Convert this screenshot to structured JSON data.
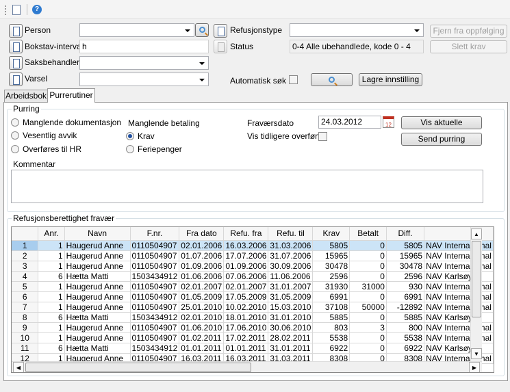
{
  "toolbar": {
    "icons": [
      "info-document-icon",
      "help-icon"
    ]
  },
  "filters": {
    "person_label": "Person",
    "person_value": "",
    "bokstav_label": "Bokstav-interval",
    "bokstav_value": "h",
    "saksbehandler_label": "Saksbehandler",
    "saksbehandler_value": "",
    "varsel_label": "Varsel",
    "varsel_value": "",
    "refusjonstype_label": "Refusjonstype",
    "refusjonstype_value": "",
    "status_label": "Status",
    "status_value": "0-4 Alle ubehandlede, kode 0 - 4",
    "automatisk_label": "Automatisk søk",
    "automatisk_checked": false,
    "fjern_label": "Fjern fra oppfølging",
    "slett_label": "Slett krav",
    "lagre_label": "Lagre innstilling"
  },
  "tabs": [
    {
      "label": "Arbeidsbok",
      "active": false
    },
    {
      "label": "Purrerutiner",
      "active": true
    }
  ],
  "purring": {
    "title": "Purring",
    "radios1": [
      "Manglende dokumentasjon",
      "Vesentlig avvik",
      "Overføres til HR"
    ],
    "heading2": "Manglende betaling",
    "radios2": [
      "Krav",
      "Feriepenger"
    ],
    "selected": "Krav",
    "fravaer_label": "Fraværsdato",
    "fravaer_value": "24.03.2012",
    "vis_tidligere_label": "Vis tidligere overført",
    "vis_tidligere_checked": false,
    "vis_aktuelle": "Vis aktuelle",
    "send_purring": "Send purring",
    "kommentar_label": "Kommentar",
    "kommentar_value": ""
  },
  "grid": {
    "title": "Refusjonsberettighet fravær",
    "columns": [
      "Anr.",
      "Navn",
      "F.nr.",
      "Fra dato",
      "Refu. fra",
      "Refu. til",
      "Krav",
      "Betalt",
      "Diff.",
      ""
    ],
    "rows": [
      [
        "1",
        "1",
        "Haugerud Anne",
        "0110504907",
        "02.01.2006",
        "16.03.2006",
        "31.03.2006",
        "5805",
        "0",
        "5805",
        "NAV Internasjonal"
      ],
      [
        "2",
        "1",
        "Haugerud Anne",
        "0110504907",
        "01.07.2006",
        "17.07.2006",
        "31.07.2006",
        "15965",
        "0",
        "15965",
        "NAV Internasjonal"
      ],
      [
        "3",
        "1",
        "Haugerud Anne",
        "0110504907",
        "01.09.2006",
        "01.09.2006",
        "30.09.2006",
        "30478",
        "0",
        "30478",
        "NAV Internasjonal"
      ],
      [
        "4",
        "6",
        "Hætta Matti",
        "1503434912",
        "01.06.2006",
        "07.06.2006",
        "11.06.2006",
        "2596",
        "0",
        "2596",
        "NAV Karlsøy"
      ],
      [
        "5",
        "1",
        "Haugerud Anne",
        "0110504907",
        "02.01.2007",
        "02.01.2007",
        "31.01.2007",
        "31930",
        "31000",
        "930",
        "NAV Internasjonal"
      ],
      [
        "6",
        "1",
        "Haugerud Anne",
        "0110504907",
        "01.05.2009",
        "17.05.2009",
        "31.05.2009",
        "6991",
        "0",
        "6991",
        "NAV Internasjonal"
      ],
      [
        "7",
        "1",
        "Haugerud Anne",
        "0110504907",
        "25.01.2010",
        "10.02.2010",
        "15.03.2010",
        "37108",
        "50000",
        "-12892",
        "NAV Internasjonal"
      ],
      [
        "8",
        "6",
        "Hætta Matti",
        "1503434912",
        "02.01.2010",
        "18.01.2010",
        "31.01.2010",
        "5885",
        "0",
        "5885",
        "NAV Karlsøy"
      ],
      [
        "9",
        "1",
        "Haugerud Anne",
        "0110504907",
        "01.06.2010",
        "17.06.2010",
        "30.06.2010",
        "803",
        "3",
        "800",
        "NAV Internasjonal"
      ],
      [
        "10",
        "1",
        "Haugerud Anne",
        "0110504907",
        "01.02.2011",
        "17.02.2011",
        "28.02.2011",
        "5538",
        "0",
        "5538",
        "NAV Internasjonal"
      ],
      [
        "11",
        "6",
        "Hætta Matti",
        "1503434912",
        "01.01.2011",
        "01.01.2011",
        "31.01.2011",
        "6922",
        "0",
        "6922",
        "NAV Karlsøy"
      ],
      [
        "12",
        "1",
        "Haugerud Anne",
        "0110504907",
        "16.03.2011",
        "16.03.2011",
        "31.03.2011",
        "8308",
        "0",
        "8308",
        "NAV Internasjonal"
      ]
    ],
    "selected_row": 1
  }
}
